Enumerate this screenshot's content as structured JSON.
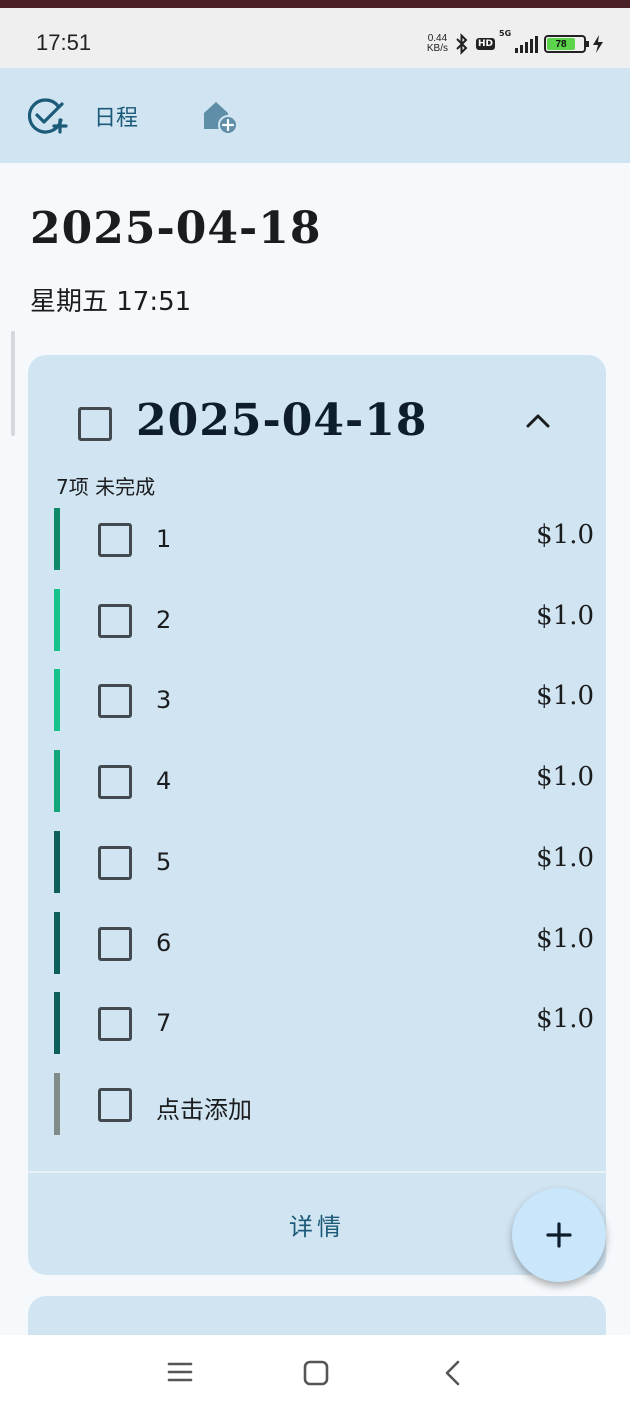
{
  "status_bar": {
    "time": "17:51",
    "net_speed_value": "0.44",
    "net_speed_unit": "KB/s",
    "hd_label": "HD",
    "signal_label": "5G",
    "battery_level": "78"
  },
  "app_bar": {
    "schedule_tab_label": "日程",
    "schedule_icon": "calendar-check-add-icon",
    "add_home_icon": "home-add-icon"
  },
  "header": {
    "date": "2025-04-18",
    "weekday_time": "星期五 17:51"
  },
  "card": {
    "date": "2025-04-18",
    "summary": "7项 未完成",
    "tasks": [
      {
        "name": "1",
        "price": "$1.0",
        "color": "#0e8a6a"
      },
      {
        "name": "2",
        "price": "$1.0",
        "color": "#15c28a"
      },
      {
        "name": "3",
        "price": "$1.0",
        "color": "#15c28a"
      },
      {
        "name": "4",
        "price": "$1.0",
        "color": "#12a67a"
      },
      {
        "name": "5",
        "price": "$1.0",
        "color": "#0e5e5c"
      },
      {
        "name": "6",
        "price": "$1.0",
        "color": "#0e5e5c"
      },
      {
        "name": "7",
        "price": "$1.0",
        "color": "#0e5e5c"
      }
    ],
    "add_placeholder": "点击添加",
    "add_bar_color": "#7f8c8a",
    "details_label": "详情"
  },
  "fab": {
    "icon": "plus-icon"
  },
  "nav": {
    "menu_icon": "menu-icon",
    "home_icon": "square-home-icon",
    "back_icon": "back-chevron-icon"
  }
}
